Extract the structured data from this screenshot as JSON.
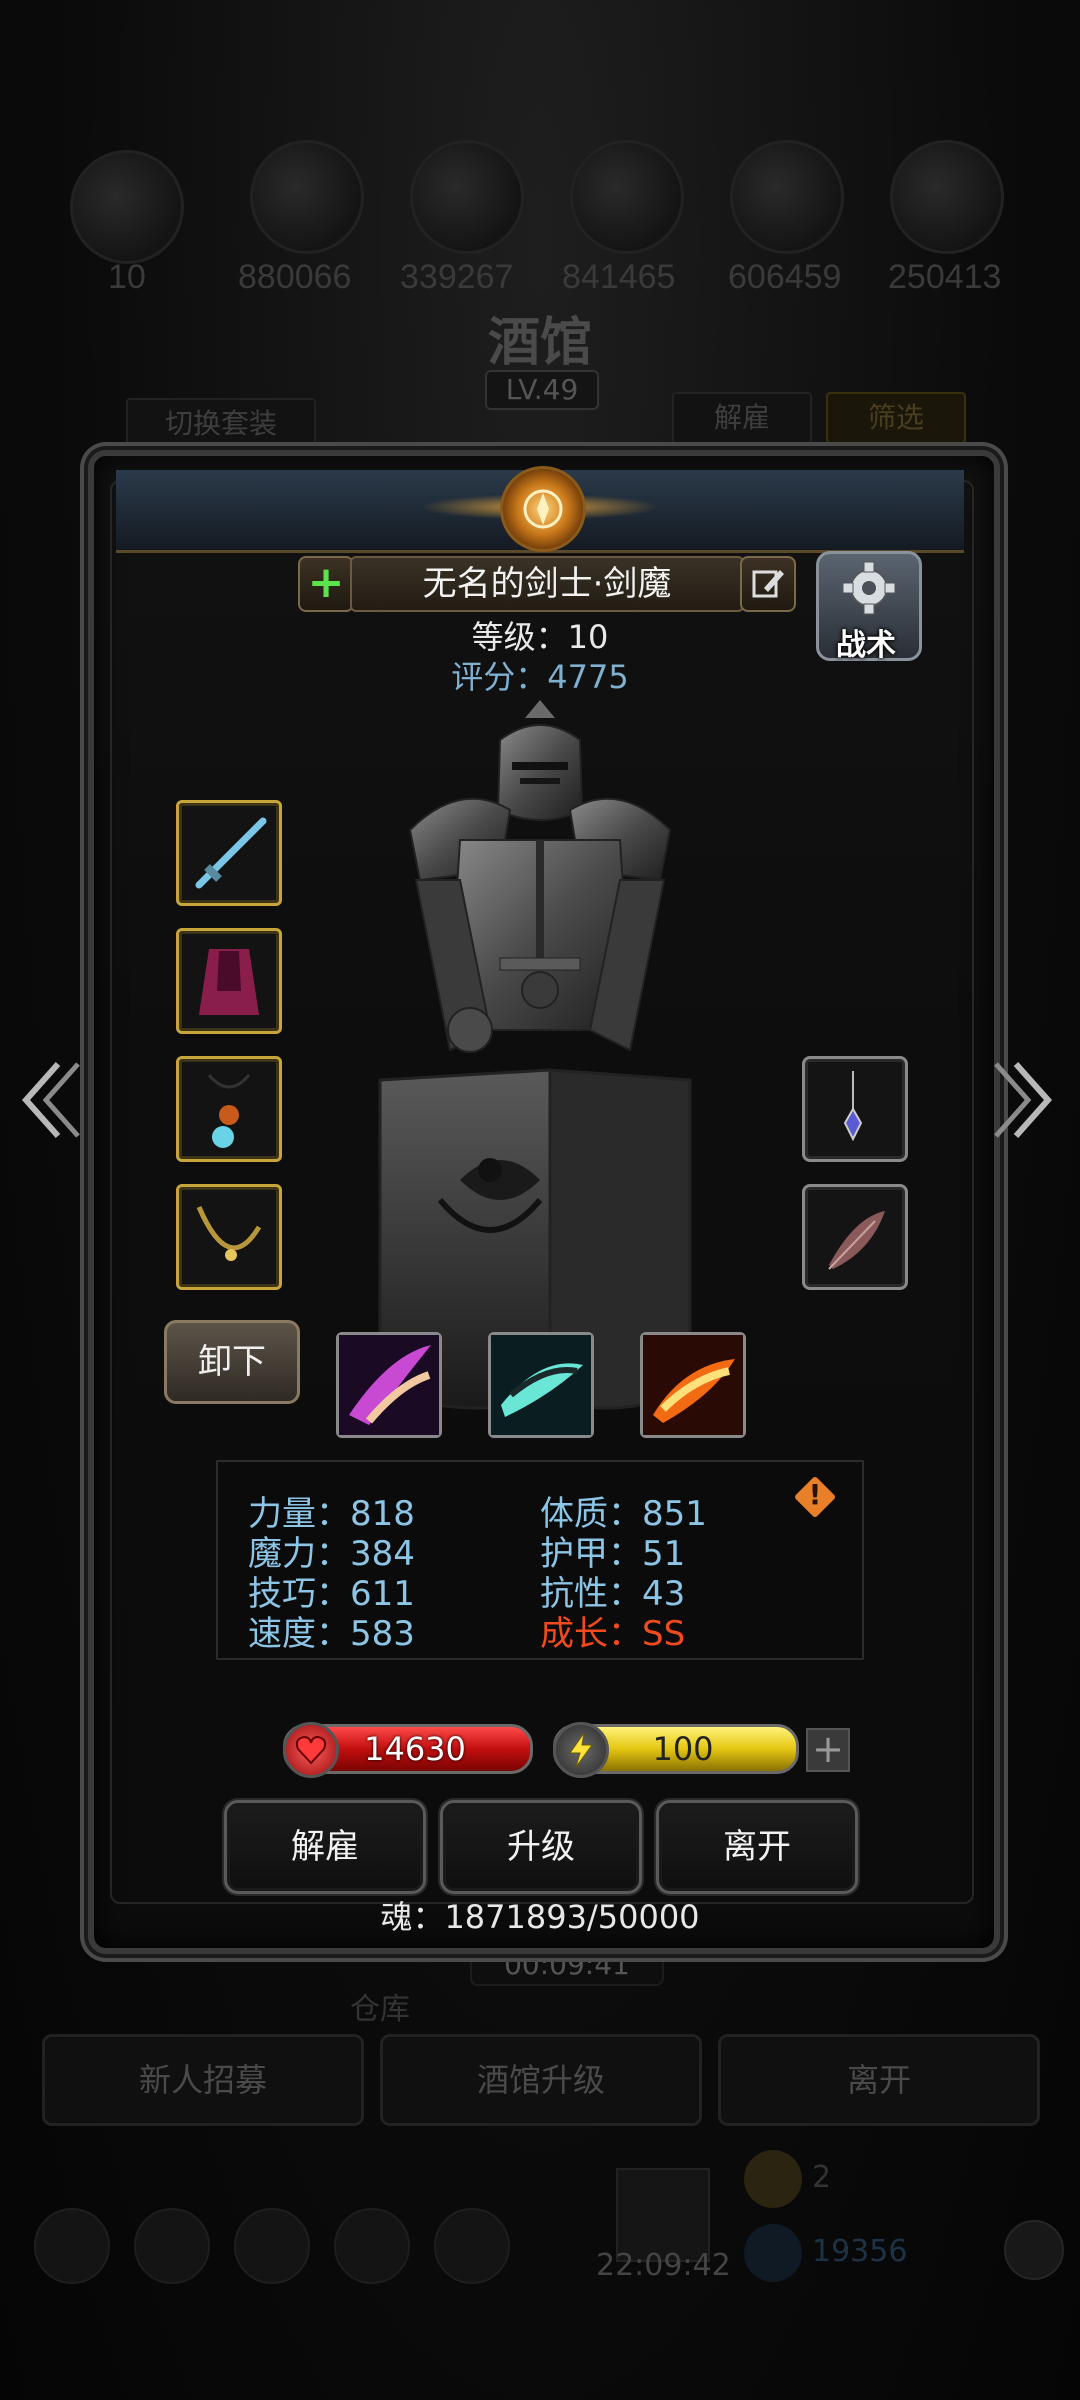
{
  "background": {
    "numbers": [
      "10",
      "880066",
      "339267",
      "841465",
      "606459",
      "250413"
    ],
    "title": "酒馆",
    "level": "LV.49",
    "switch_outfit": "切换套装",
    "dismiss": "解雇",
    "filter": "筛选",
    "timer": "00:09:41",
    "warehouse": "仓库",
    "recruit": "新人招募",
    "upgrade_tavern": "酒馆升级",
    "leave": "离开",
    "clock": "22:09:42",
    "small_number": "2",
    "bottom_number": "19356"
  },
  "hero": {
    "name": "无名的剑士·剑魔",
    "level": "等级：10",
    "score": "评分：4775",
    "tactics": "战术",
    "unequip": "卸下"
  },
  "stats": {
    "strength": "力量：818",
    "magic": "魔力：384",
    "skill": "技巧：611",
    "speed": "速度：583",
    "constitution": "体质：851",
    "armor": "护甲：51",
    "resist": "抗性：43",
    "growth": "成长：SS"
  },
  "bars": {
    "hp": "14630",
    "energy": "100",
    "hp_fill": 1.0,
    "energy_fill": 1.0
  },
  "actions": {
    "dismiss": "解雇",
    "upgrade": "升级",
    "leave": "离开"
  },
  "soul": "魂：1871893/50000",
  "colors": {
    "gold_border": "#c7a53a",
    "stat_blue": "#8cc5e6",
    "growth_red": "#f04a1e",
    "hp_red": "#c20e0e",
    "energy_yellow": "#e4c612"
  },
  "icons": [
    "plus-icon",
    "edit-icon",
    "gear-icon",
    "sword-icon",
    "cloak-icon",
    "amulet-icon",
    "necklace-icon",
    "pendant-icon",
    "feather-icon",
    "skill-slash-icon",
    "skill-wind-icon",
    "skill-fire-icon",
    "heart-icon",
    "bolt-icon",
    "warning-icon",
    "arrow-left-icon",
    "arrow-right-icon"
  ]
}
